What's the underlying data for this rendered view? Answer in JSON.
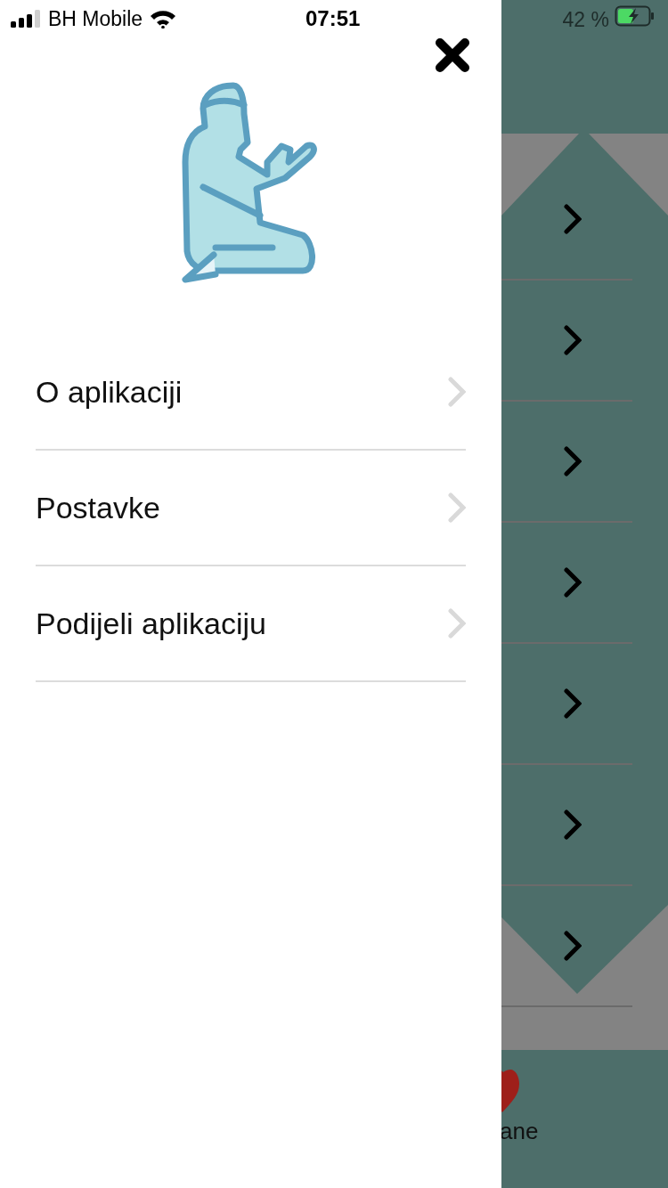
{
  "status_bar": {
    "carrier": "BH Mobile",
    "time": "07:51",
    "battery": "42 %"
  },
  "menu": {
    "items": [
      {
        "label": "O aplikaciji"
      },
      {
        "label": "Postavke"
      },
      {
        "label": "Podijeli aplikaciju"
      }
    ]
  },
  "background_list": {
    "rows": [
      {
        "kind": "chevron"
      },
      {
        "kind": "chevron"
      },
      {
        "kind": "chevron"
      },
      {
        "kind": "chevron"
      },
      {
        "kind": "chevron"
      },
      {
        "kind": "chevron"
      },
      {
        "kind": "chevron"
      }
    ]
  },
  "tab_bar": {
    "label": "ane"
  }
}
